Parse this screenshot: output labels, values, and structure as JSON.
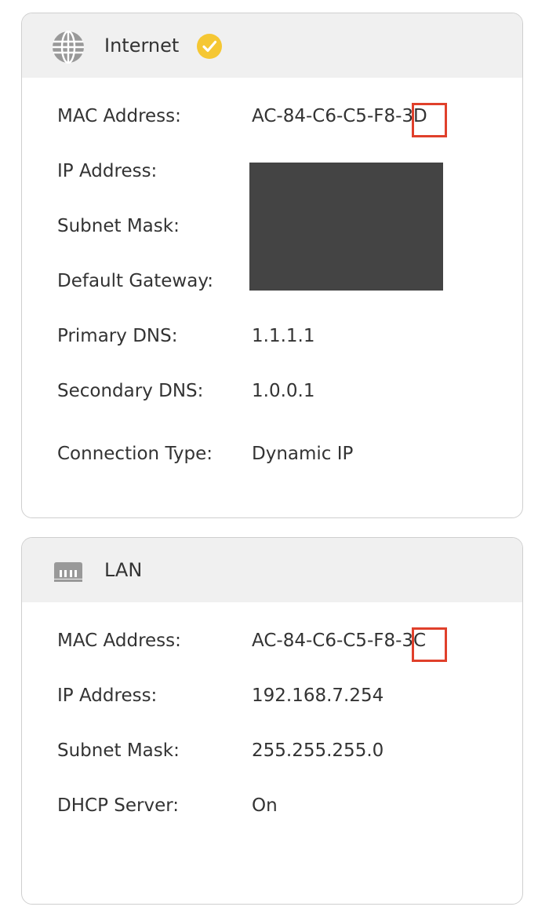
{
  "colors": {
    "panel_border": "#cfcfcf",
    "header_bg": "#f0f0f0",
    "check_badge": "#f5c733",
    "highlight": "#e0402b",
    "redaction": "#444444"
  },
  "internet": {
    "title": "Internet",
    "icon": "globe-icon",
    "status_icon": "check-circle-icon",
    "rows": [
      {
        "label": "MAC Address:",
        "value": "AC-84-C6-C5-F8-3D"
      },
      {
        "label": "IP Address:",
        "value": ""
      },
      {
        "label": "Subnet Mask:",
        "value": ""
      },
      {
        "label": "Default Gateway:",
        "value": ""
      },
      {
        "label": "Primary DNS:",
        "value": "1.1.1.1"
      },
      {
        "label": "Secondary DNS:",
        "value": "1.0.0.1"
      },
      {
        "label": "Connection Type:",
        "value": "Dynamic IP"
      }
    ]
  },
  "lan": {
    "title": "LAN",
    "icon": "ethernet-port-icon",
    "rows": [
      {
        "label": "MAC Address:",
        "value": "AC-84-C6-C5-F8-3C"
      },
      {
        "label": "IP Address:",
        "value": "192.168.7.254"
      },
      {
        "label": "Subnet Mask:",
        "value": "255.255.255.0"
      },
      {
        "label": "DHCP Server:",
        "value": "On"
      }
    ]
  }
}
